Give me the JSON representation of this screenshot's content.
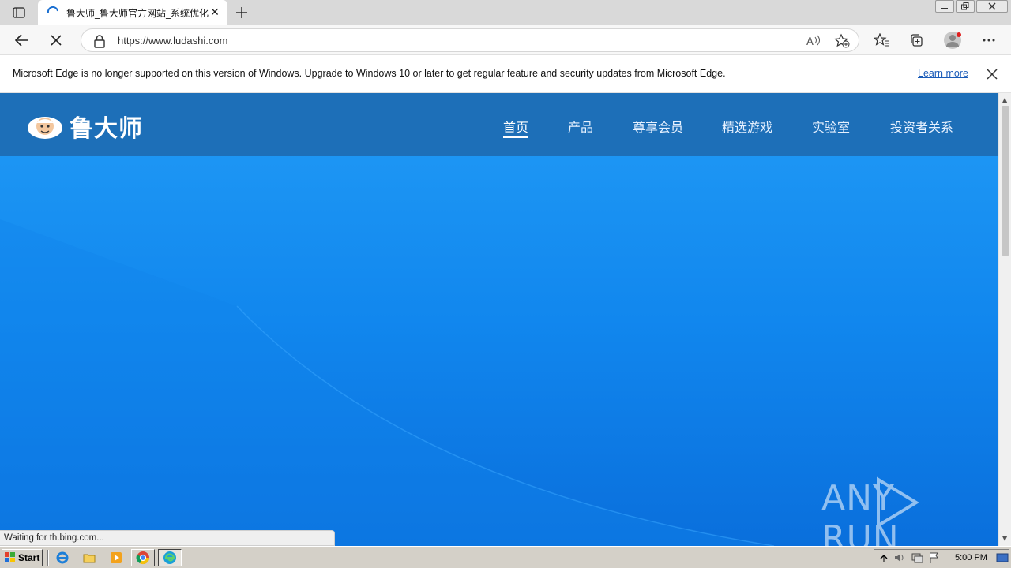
{
  "browser": {
    "tab": {
      "title": "鲁大师_鲁大师官方网站_系统优化",
      "close_glyph": "✕"
    },
    "new_tab_glyph": "+",
    "address": {
      "url": "https://www.ludashi.com"
    },
    "infobar": {
      "message": "Microsoft Edge is no longer supported on this version of Windows. Upgrade to Windows 10 or later to get regular feature and security updates from Microsoft Edge.",
      "link": "Learn more"
    },
    "status": "Waiting for th.bing.com..."
  },
  "site": {
    "brand": "鲁大师",
    "nav": [
      {
        "label": "首页",
        "active": true
      },
      {
        "label": "产品"
      },
      {
        "label": "尊享会员"
      },
      {
        "label": "精选游戏"
      },
      {
        "label": "实验室"
      },
      {
        "label": "投资者关系"
      }
    ]
  },
  "watermark": {
    "text": "ANY RUN"
  },
  "taskbar": {
    "start_label": "Start",
    "clock": "5:00 PM"
  },
  "colors": {
    "header": "#1d6fb8",
    "hero_top": "#219bf6",
    "hero_bottom": "#0a6fdc",
    "link": "#1a5bb8"
  }
}
